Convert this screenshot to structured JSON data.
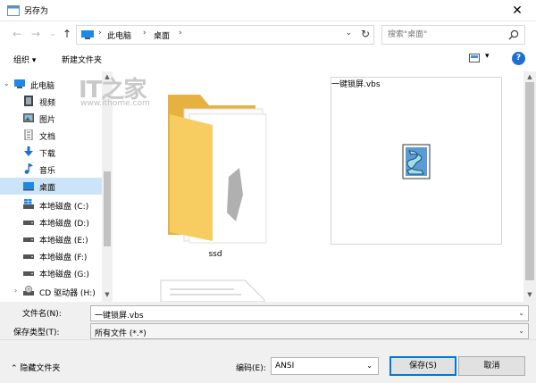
{
  "window": {
    "title": "另存为",
    "close_glyph": "✕"
  },
  "nav": {
    "back_glyph": "←",
    "forward_glyph": "→",
    "recent_glyph": "⌄",
    "up_glyph": "↑",
    "breadcrumbs": [
      "此电脑",
      "桌面"
    ],
    "sep_glyph": "›",
    "dropdown_glyph": "⌄",
    "refresh_glyph": "↻",
    "search_placeholder": "搜索\"桌面\""
  },
  "toolbar": {
    "organize_label": "组织 ▾",
    "new_folder_label": "新建文件夹",
    "view_drop_glyph": "▾",
    "help_label": "?"
  },
  "sidebar": {
    "items": [
      {
        "label": "此电脑",
        "icon": "computer-icon",
        "root": true,
        "expand": "⌄"
      },
      {
        "label": "视频",
        "icon": "video-icon"
      },
      {
        "label": "图片",
        "icon": "pictures-icon"
      },
      {
        "label": "文档",
        "icon": "documents-icon"
      },
      {
        "label": "下载",
        "icon": "download-icon"
      },
      {
        "label": "音乐",
        "icon": "music-icon"
      },
      {
        "label": "桌面",
        "icon": "desktop-icon",
        "selected": true
      },
      {
        "label": "本地磁盘 (C:)",
        "icon": "windows-drive-icon"
      },
      {
        "label": "本地磁盘 (D:)",
        "icon": "drive-icon"
      },
      {
        "label": "本地磁盘 (E:)",
        "icon": "drive-icon"
      },
      {
        "label": "本地磁盘 (F:)",
        "icon": "drive-icon"
      },
      {
        "label": "本地磁盘 (G:)",
        "icon": "drive-icon"
      },
      {
        "label": "CD 驱动器 (H:)",
        "icon": "cd-drive-icon",
        "expand": "›"
      }
    ]
  },
  "watermark": {
    "logo": "IT之家",
    "url": "www.ithome.com"
  },
  "files": [
    {
      "name": "ssd",
      "type": "folder"
    },
    {
      "name": "一键锁屏.vbs",
      "type": "vbs-script"
    },
    {
      "name": "",
      "type": "document"
    }
  ],
  "form": {
    "filename_label": "文件名(N):",
    "filename_value": "一键锁屏.vbs",
    "filetype_label": "保存类型(T):",
    "filetype_value": "所有文件  (*.*)",
    "dropdown_glyph": "⌄"
  },
  "bottom": {
    "hide_folders_label": "⌃  隐藏文件夹",
    "encoding_label": "编码(E):",
    "encoding_value": "ANSI",
    "save_label": "保存(S)",
    "cancel_label": "取消"
  },
  "scroll": {
    "up_glyph": "▲",
    "down_glyph": "▼"
  },
  "colors": {
    "selection": "#cce4f7",
    "accent": "#0078d7",
    "folder": "#f2c355"
  }
}
